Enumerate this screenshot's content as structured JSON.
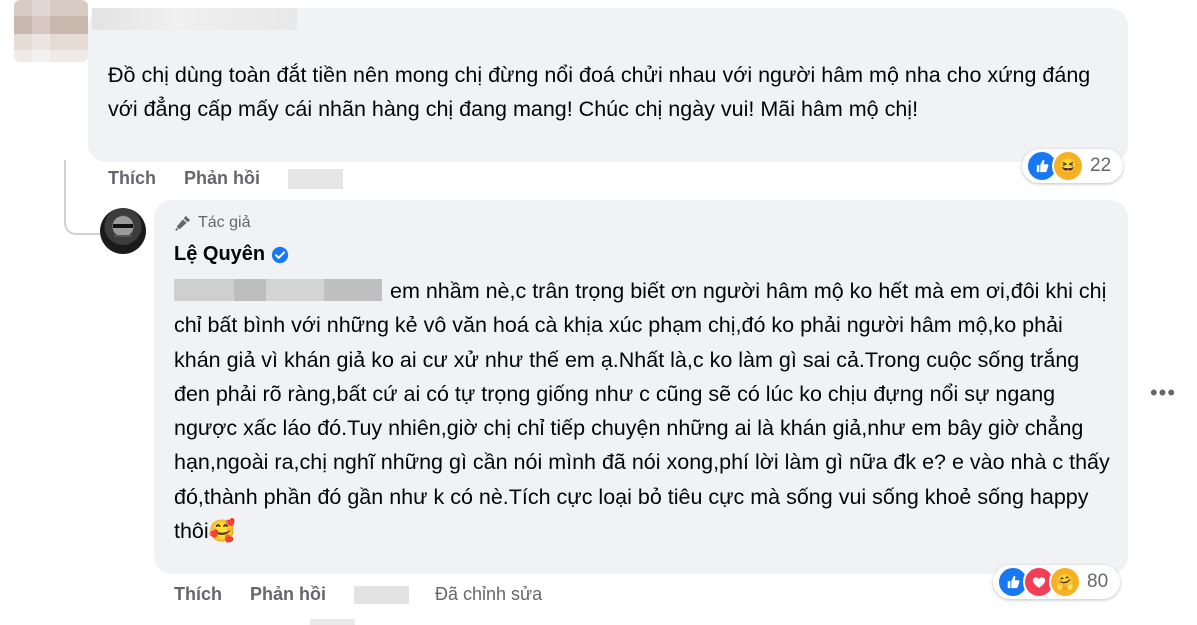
{
  "comment": {
    "text": "Đồ chị dùng toàn đắt tiền nên mong chị đừng nổi đoá chửi nhau với người hâm mộ nha cho xứng đáng với đẳng cấp mấy cái nhãn hàng chị đang mang! Chúc chị ngày vui! Mãi hâm mộ chị!",
    "reaction_icons": [
      "like-icon",
      "haha-icon"
    ],
    "reaction_count": "22",
    "actions": {
      "like": "Thích",
      "reply": "Phản hồi"
    }
  },
  "reply": {
    "author_badge": "Tác giả",
    "author_name": "Lệ Quyên",
    "text": "em nhầm nè,c trân trọng biết ơn người hâm mộ ko hết mà em ơi,đôi khi chị chỉ bất bình với những kẻ vô văn hoá cà khịa xúc phạm chị,đó ko phải người hâm mộ,ko phải khán giả vì khán giả ko ai cư xử như thế em ạ.Nhất là,c ko làm gì sai cả.Trong cuộc sống trắng đen phải rõ ràng,bất cứ ai có tự trọng giống như c cũng sẽ có lúc ko chịu đựng nổi sự ngang ngược xấc láo đó.Tuy nhiên,giờ chị chỉ tiếp chuyện những ai là khán giả,như em bây giờ chẳng hạn,ngoài ra,chị nghĩ những gì cần nói mình đã nói xong,phí lời làm gì nữa đk e? e vào nhà c thấy đó,thành phần đó gần như k có nè.Tích cực loại bỏ tiêu cực mà sống vui sống khoẻ sống happy thôi",
    "trailing_emoji": "🥰",
    "reaction_icons": [
      "like-icon",
      "love-icon",
      "care-icon"
    ],
    "reaction_count": "80",
    "actions": {
      "like": "Thích",
      "reply": "Phản hồi",
      "edited": "Đã chỉnh sửa"
    }
  },
  "colors": {
    "like": "#1877f2",
    "love": "#f33e58",
    "haha": "#f7b125",
    "muted": "#65676b",
    "bubble": "#f0f2f5"
  },
  "more_icon": "more-horizontal-icon"
}
